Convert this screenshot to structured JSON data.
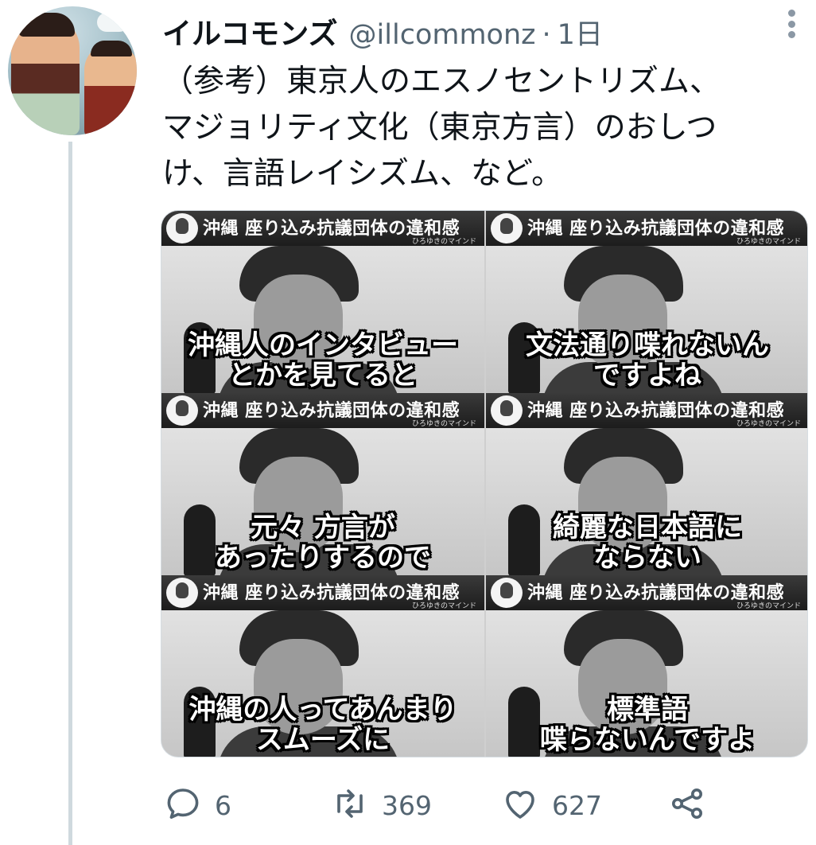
{
  "tweet": {
    "display_name": "イルコモンズ",
    "handle": "@illcommonz",
    "separator": "·",
    "time": "1日",
    "text_lines": [
      "（参考）東京人のエスノセントリズム、",
      "マジョリティ文化（東京方言）のおしつ",
      "け、言語レイシズム、など。"
    ]
  },
  "media": {
    "panels": [
      {
        "banner": "沖縄 座り込み抗議団体の違和感",
        "sub": "ひろゆきのマインド",
        "caption_line1": "沖縄人のインタビュー",
        "caption_line2": "とかを見てると"
      },
      {
        "banner": "沖縄 座り込み抗議団体の違和感",
        "sub": "ひろゆきのマインド",
        "caption_line1": "文法通り喋れないん",
        "caption_line2": "ですよね"
      },
      {
        "banner": "沖縄 座り込み抗議団体の違和感",
        "sub": "ひろゆきのマインド",
        "caption_line1": "元々 方言が",
        "caption_line2": "あったりするので"
      },
      {
        "banner": "沖縄 座り込み抗議団体の違和感",
        "sub": "ひろゆきのマインド",
        "caption_line1": "綺麗な日本語に",
        "caption_line2": "ならない"
      },
      {
        "banner": "沖縄 座り込み抗議団体の違和感",
        "sub": "ひろゆきのマインド",
        "caption_line1": "沖縄の人ってあんまり",
        "caption_line2": "スムーズに"
      },
      {
        "banner": "沖縄 座り込み抗議団体の違和感",
        "sub": "ひろゆきのマインド",
        "caption_line1": "標準語",
        "caption_line2": "喋らないんですよ"
      }
    ]
  },
  "actions": {
    "reply_icon": "reply-icon",
    "reply_count": "6",
    "retweet_icon": "retweet-icon",
    "retweet_count": "369",
    "like_icon": "heart-icon",
    "like_count": "627",
    "share_icon": "share-icon"
  },
  "colors": {
    "text_primary": "#0f1419",
    "text_secondary": "#536471",
    "thread_line": "#cfd9de"
  }
}
